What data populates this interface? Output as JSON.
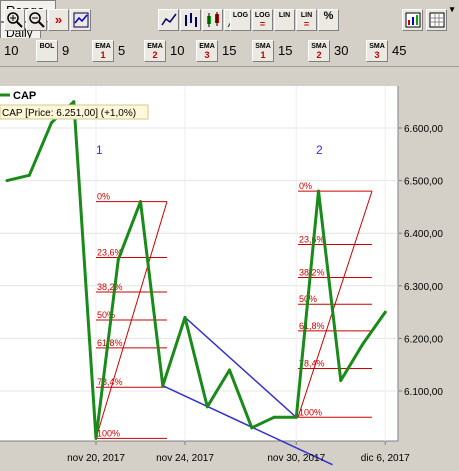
{
  "toolbar": {
    "range_label": "Range",
    "period_label": "Daily",
    "scale_buttons": [
      {
        "top": "LOG",
        "bottom": ""
      },
      {
        "top": "LOG",
        "bottom": "="
      },
      {
        "top": "LIN",
        "bottom": ""
      },
      {
        "top": "LIN",
        "bottom": "="
      },
      {
        "top": "%",
        "bottom": ""
      }
    ]
  },
  "indicators": [
    {
      "badge": "",
      "num": "",
      "value": "10"
    },
    {
      "badge": "BOL",
      "num": "",
      "value": "9"
    },
    {
      "badge": "EMA",
      "num": "1",
      "value": "5"
    },
    {
      "badge": "EMA",
      "num": "2",
      "value": "10"
    },
    {
      "badge": "EMA",
      "num": "3",
      "value": "15"
    },
    {
      "badge": "SMA",
      "num": "1",
      "value": "15"
    },
    {
      "badge": "SMA",
      "num": "2",
      "value": "30"
    },
    {
      "badge": "SMA",
      "num": "3",
      "value": "45"
    }
  ],
  "legend": {
    "series_name": "CAP",
    "price_text": "CAP [Price: 6.251,00] (+1,0%)"
  },
  "colors": {
    "series": "#1a8a1a",
    "fib": "#cc0000",
    "trend": "#3333cc",
    "panel": "#ffffff",
    "toolbar": "#d4d0c8"
  },
  "chart_data": {
    "type": "line",
    "series": [
      {
        "name": "CAP",
        "values": [
          6500,
          6510,
          6610,
          6650,
          6010,
          6350,
          6460,
          6110,
          6240,
          6070,
          6140,
          6030,
          6050,
          6050,
          6480,
          6120,
          6190,
          6250
        ]
      }
    ],
    "x_ticks": [
      "nov 20, 2017",
      "nov 24, 2017",
      "nov 30, 2017",
      "dic 6, 2017"
    ],
    "y_ticks": [
      "6.100,00",
      "6.200,00",
      "6.300,00",
      "6.400,00",
      "6.500,00",
      "6.600,00"
    ],
    "ylim": [
      6000,
      6700
    ],
    "annotations": [
      "1",
      "2"
    ],
    "fib_levels": [
      "0%",
      "23,6%",
      "38,2%",
      "50%",
      "61,8%",
      "78,4%",
      "100%"
    ],
    "grid": true
  }
}
